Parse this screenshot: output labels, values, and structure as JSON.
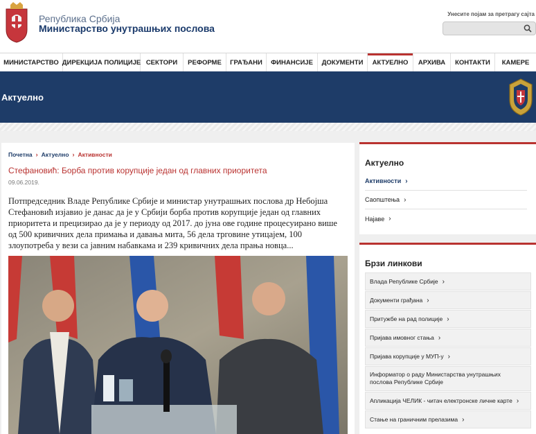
{
  "header": {
    "line1": "Република Србија",
    "line2": "Министарство унутрашњих послова",
    "search_hint": "Унесите појам за претрагу сајта",
    "search_value": ""
  },
  "nav": {
    "items": [
      "МИНИСТАРСТВО",
      "ДИРЕКЦИЈА ПОЛИЦИЈЕ",
      "СЕКТОРИ",
      "РЕФОРМЕ",
      "ГРАЂАНИ",
      "ФИНАНСИЈЕ",
      "ДОКУМЕНТИ",
      "АКТУЕЛНО",
      "АРХИВА",
      "КОНТАКТИ",
      "КАМЕРЕ"
    ],
    "active": "АКТУЕЛНО"
  },
  "banner": {
    "title": "Актуелно"
  },
  "breadcrumb": [
    "Почетна",
    "Актуелно",
    "Активности"
  ],
  "article": {
    "title": "Стефановић: Борба против корупције један од главних приоритета",
    "date": "09.06.2019.",
    "body": "Потпредседник Владе Републике Србије и министар унутрашњих послова др Небојша Стефановић изјавио је данас да је у Србији борба против корупције један од главних приоритета и прецизирао да је у периоду од 2017. до јуна ове године процесуирано више од 500 кривичних дела примања и давања мита, 56 дела трговине утицајем, 100 злоупотреба у вези са јавним набавкама и 239 кривичних дела прања новца..."
  },
  "sidebar": {
    "section1": {
      "title": "Актуелно",
      "links": [
        {
          "label": "Активности",
          "active": true
        },
        {
          "label": "Саопштења",
          "active": false
        },
        {
          "label": "Најаве",
          "active": false
        }
      ]
    },
    "section2": {
      "title": "Брзи линкови",
      "links": [
        "Влада Републике Србије",
        "Документи грађана",
        "Притужбе на рад полиције",
        "Пријава имовног стања",
        "Пријава корупције у МУП-у",
        "Информатор о раду Министарства унутрашњих послова Републике Србије",
        "Апликација ЧЕЛИК - читач електронске личне карте",
        "Стање на граничним прелазима"
      ]
    }
  },
  "colors": {
    "navy": "#1e3c68",
    "accent_red": "#b93230"
  }
}
